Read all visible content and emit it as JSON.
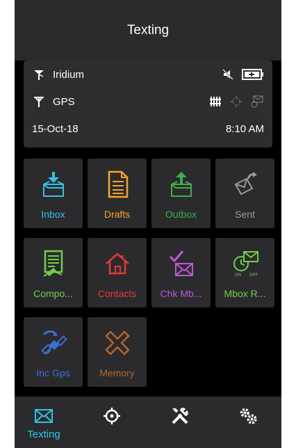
{
  "header": {
    "title": "Texting"
  },
  "status": {
    "network1": "Iridium",
    "network2": "GPS",
    "date": "15-Oct-18",
    "time": "8:10 AM"
  },
  "tiles": [
    {
      "label": "Inbox",
      "color": "#2ec4e6",
      "icon": "inbox-icon"
    },
    {
      "label": "Drafts",
      "color": "#f5a623",
      "icon": "drafts-icon"
    },
    {
      "label": "Outbox",
      "color": "#3fae49",
      "icon": "outbox-icon"
    },
    {
      "label": "Sent",
      "color": "#9a9a9a",
      "icon": "sent-icon"
    },
    {
      "label": "Compo...",
      "color": "#6ed14a",
      "icon": "compose-icon"
    },
    {
      "label": "Contacts",
      "color": "#e53935",
      "icon": "contacts-icon"
    },
    {
      "label": "Chk Mb...",
      "color": "#c157d9",
      "icon": "check-mailbox-icon"
    },
    {
      "label": "Mbox R...",
      "color": "#6ed14a",
      "icon": "mailbox-reminder-icon"
    },
    {
      "label": "Inc Gps",
      "color": "#3d6fd6",
      "icon": "satellite-icon"
    },
    {
      "label": "Memory",
      "color": "#b5652b",
      "icon": "memory-icon"
    }
  ],
  "nav": {
    "texting_label": "Texting",
    "accent": "#2ec4e6"
  }
}
